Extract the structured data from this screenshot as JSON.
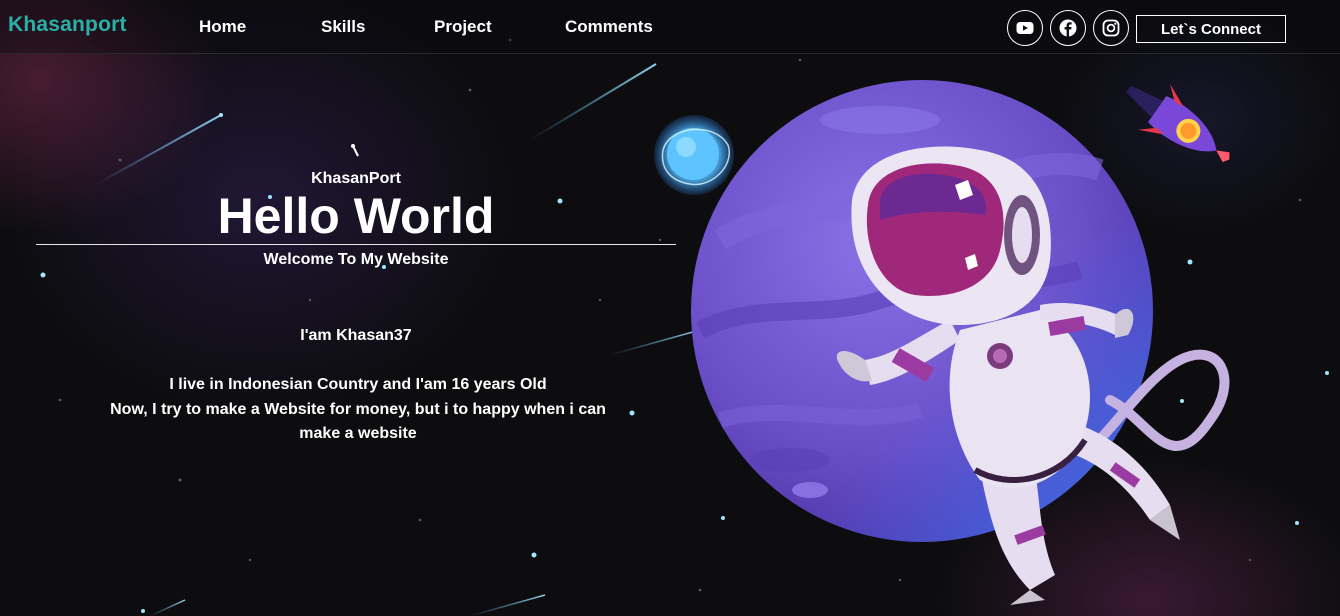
{
  "nav": {
    "brand": "Khasanport",
    "links": [
      "Home",
      "Skills",
      "Project",
      "Comments"
    ],
    "social_icons": [
      "youtube-icon",
      "facebook-icon",
      "instagram-icon"
    ],
    "connect_label": "Let`s Connect"
  },
  "hero": {
    "tagline": "KhasanPort",
    "title": "Hello World",
    "subtitle": "Welcome To My Website",
    "intro": "I'am Khasan37",
    "bio_line1": "I live in Indonesian Country and I'am 16 years Old",
    "bio_line2": "Now, I try to make a Website for money, but i to happy when i can make a website"
  },
  "colors": {
    "brand": "#2bb0a6",
    "background": "#0d0d10",
    "planet": "#6a4fc8",
    "suit": "#e6def0",
    "visor": "#a0287a"
  }
}
